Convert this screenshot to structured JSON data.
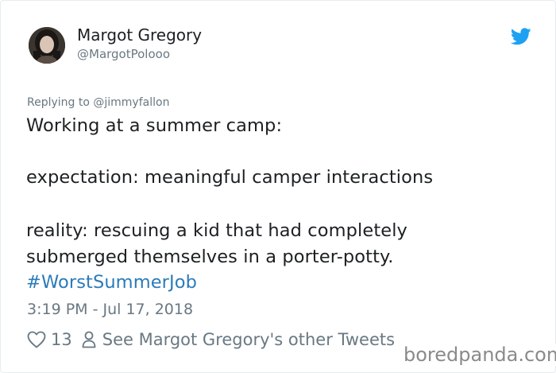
{
  "tweet": {
    "author": {
      "display_name": "Margot Gregory",
      "handle": "@MargotPolooo"
    },
    "reply_to": "Replying to @jimmyfallon",
    "body_lines": [
      "Working at a summer camp:",
      "expectation: meaningful camper interactions",
      "reality: rescuing a kid that had completely",
      "submerged themselves in a porter-potty."
    ],
    "hashtag": "#WorstSummerJob",
    "timestamp": "3:19 PM - Jul 17, 2018",
    "like_count": "13",
    "see_more_label": "See Margot Gregory's other Tweets"
  },
  "watermark": "boredpanda.com",
  "icons": {
    "brand": "twitter-bird-icon",
    "like": "heart-icon",
    "profile": "person-icon"
  },
  "colors": {
    "twitter_blue": "#1da1f2",
    "hashtag": "#2b7bb9",
    "muted_text": "#697882",
    "body_text": "#1c2022"
  }
}
